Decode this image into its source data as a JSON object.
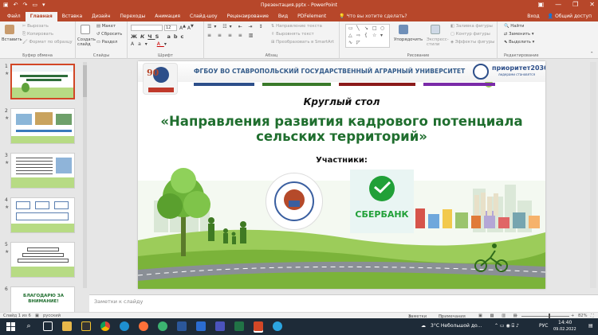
{
  "window": {
    "title": "Презентация.pptx - PowerPoint",
    "controls": [
      "—",
      "❐",
      "✕"
    ]
  },
  "tabs": {
    "items": [
      "Файл",
      "Главная",
      "Вставка",
      "Дизайн",
      "Переходы",
      "Анимация",
      "Слайд-шоу",
      "Рецензирование",
      "Вид",
      "PDFelement"
    ],
    "active": "Главная",
    "search": "Что вы хотите сделать?",
    "signin": "Вход",
    "share": "Общий доступ"
  },
  "ribbon": {
    "clipboard": {
      "paste": "Вставить",
      "cut": "Вырезать",
      "copy": "Копировать",
      "format": "Формат по образцу",
      "label": "Буфер обмена"
    },
    "slides": {
      "create": "Создать слайд",
      "layout": "Макет",
      "reset": "Сбросить",
      "section": "Раздел",
      "label": "Слайды"
    },
    "font": {
      "name": "",
      "size": "12",
      "label": "Шрифт"
    },
    "paragraph": {
      "text_dir": "Направление текста",
      "align_text": "Выровнять текст",
      "smartart": "Преобразовать в SmartArt",
      "label": "Абзац"
    },
    "drawing": {
      "arrange": "Упорядочить",
      "quick_styles": "Экспресс-стили",
      "fill": "Заливка фигуры",
      "outline": "Контур фигуры",
      "effects": "Эффекты фигуры",
      "label": "Рисование"
    },
    "editing": {
      "find": "Найти",
      "replace": "Заменить",
      "select": "Выделить",
      "label": "Редактирование"
    }
  },
  "thumbnails": [
    {
      "num": "1",
      "star": "★",
      "selected": true
    },
    {
      "num": "2",
      "star": "★",
      "selected": false
    },
    {
      "num": "3",
      "star": "★",
      "selected": false
    },
    {
      "num": "4",
      "star": "★",
      "selected": false
    },
    {
      "num": "5",
      "star": "★",
      "selected": false
    },
    {
      "num": "6",
      "star": "★",
      "selected": false,
      "text": "БЛАГОДАРЮ ЗА ВНИМАНИЕ!"
    }
  ],
  "slide": {
    "header": "ФГБОУ ВО СТАВРОПОЛЬСКИЙ ГОСУДАРСТВЕННЫЙ АГРАРНЫЙ УНИВЕРСИТЕТ",
    "badge_number": "90",
    "priority_logo": "приоритет2030",
    "priority_tagline": "лидерами становятся",
    "round_table": "Круглый стол",
    "title_line1": "«Направления развития кадрового потенциала",
    "title_line2": "сельских территорий»",
    "participants": "Участники:",
    "sber": "СБЕРБАНК",
    "stripe_colors": [
      "#2d4f8a",
      "#3a7a2a",
      "#8b1a1a",
      "#7a2aa8"
    ]
  },
  "notes": {
    "placeholder": "Заметки к слайду"
  },
  "status": {
    "slide_info": "Слайд 1 из 6",
    "language": "русский",
    "notes_btn": "Заметки",
    "comments_btn": "Примечания",
    "zoom": "82%"
  },
  "taskbar": {
    "weather": "3°С Небольшой до...",
    "lang": "РУС",
    "time": "14:40",
    "date": "09.02.2022"
  },
  "colors": {
    "accent": "#b7472a",
    "header_text": "#355c8a",
    "title_green": "#1f6e2e"
  }
}
